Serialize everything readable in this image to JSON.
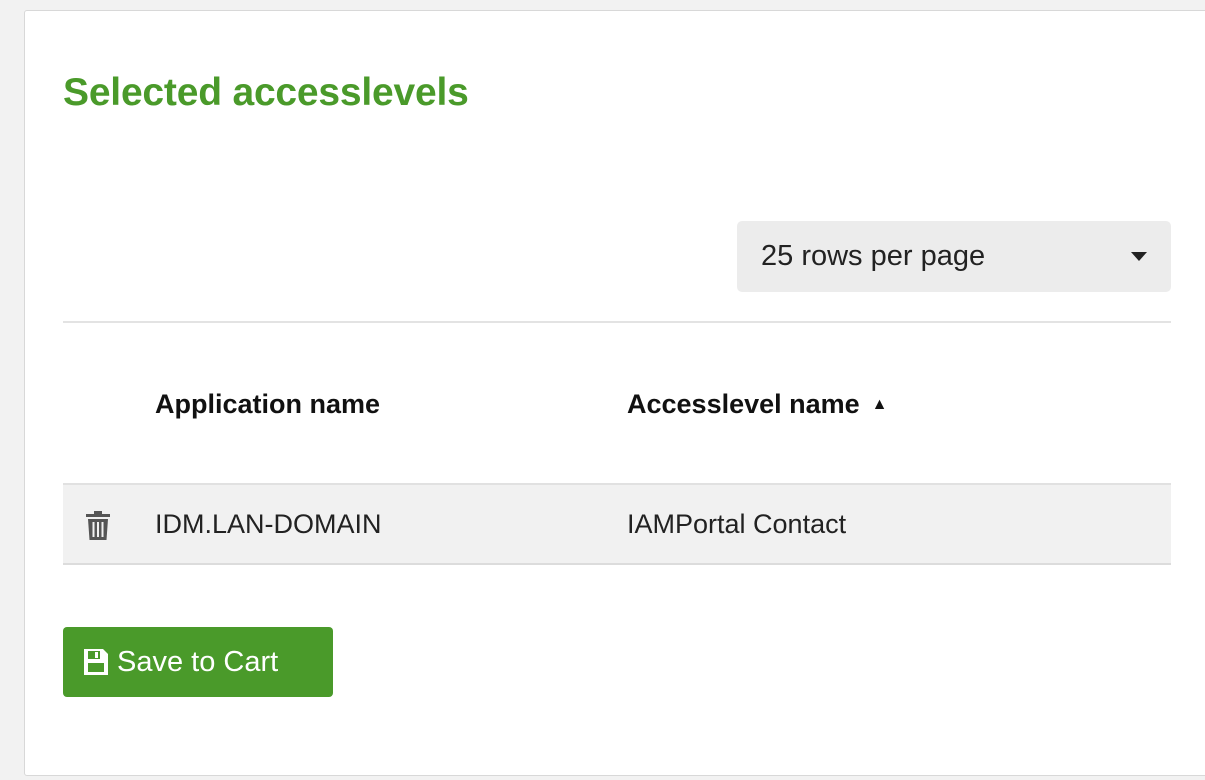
{
  "panel": {
    "title": "Selected accesslevels"
  },
  "pagination": {
    "rows_per_page_label": "25 rows per page"
  },
  "table": {
    "columns": [
      {
        "label": "Application name",
        "sort": "none"
      },
      {
        "label": "Accesslevel name",
        "sort": "ascending"
      }
    ],
    "rows": [
      {
        "application": "IDM.LAN-DOMAIN",
        "accesslevel": "IAMPortal Contact"
      }
    ]
  },
  "actions": {
    "save_label": "Save to Cart"
  },
  "icons": {
    "dropdown": "caret-down-icon",
    "sort": "sort-ascending-icon",
    "delete": "trash-icon",
    "save": "floppy-disk-icon"
  },
  "colors": {
    "accent": "#4a9a2a",
    "row_background": "#f1f1f1",
    "select_background": "#ececec"
  }
}
